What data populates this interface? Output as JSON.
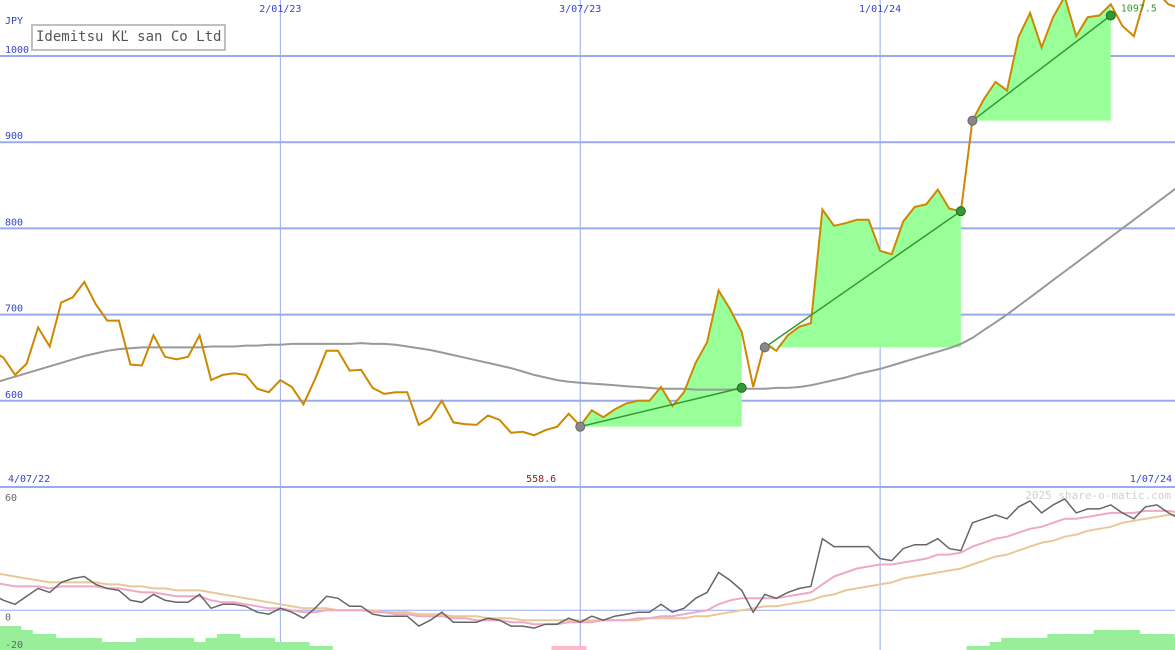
{
  "title": "Idemitsu KĽ san Co Ltd",
  "watermark": "2025 share-o-matic.com",
  "colors": {
    "price": "#cc8800",
    "ma_slow": "#999999",
    "gain_fill": "#99ff99",
    "trend": "#339933",
    "grid": "#99aaee",
    "axis_text": "#3344cc",
    "osc_line": "#666666",
    "osc_fast": "#f0a8c8",
    "osc_slow": "#e8c898",
    "hist_pos": "#99ee99",
    "hist_neg": "#ffb8c8",
    "last_label": "#339933",
    "min_label": "#882222"
  },
  "chart_data": {
    "type": "line",
    "currency": "JPY",
    "date_range": [
      "4/07/22",
      "1/07/24"
    ],
    "x_ticks": [
      {
        "label": "2/01/23",
        "i": 25
      },
      {
        "label": "3/07/23",
        "i": 51
      },
      {
        "label": "1/01/24",
        "i": 77
      }
    ],
    "y_ticks": [
      600,
      700,
      800,
      900,
      1000
    ],
    "ylim": [
      500,
      1065
    ],
    "osc_ticks": [
      60,
      0,
      -20
    ],
    "osc_lim": [
      -20,
      60
    ],
    "min_label": "558.6",
    "last_label": "1097.5",
    "price": [
      658,
      650,
      630,
      643,
      685,
      663,
      714,
      720,
      738,
      712,
      693,
      693,
      642,
      641,
      676,
      651,
      648,
      651,
      676,
      624,
      630,
      632,
      630,
      614,
      610,
      624,
      616,
      596,
      625,
      658,
      658,
      635,
      636,
      615,
      608,
      610,
      610,
      572,
      580,
      600,
      575,
      573,
      572,
      583,
      578,
      563,
      564,
      560,
      566,
      570,
      585,
      571,
      589,
      581,
      590,
      597,
      600,
      600,
      616,
      594,
      610,
      644,
      668,
      728,
      706,
      680,
      616,
      667,
      658,
      676,
      686,
      690,
      822,
      803,
      806,
      810,
      810,
      774,
      770,
      808,
      825,
      828,
      845,
      823,
      820,
      925,
      950,
      970,
      960,
      1022,
      1050,
      1010,
      1045,
      1069,
      1023,
      1045,
      1047,
      1060,
      1035,
      1023,
      1070,
      1074,
      1060,
      1055
    ],
    "ma_slow": [
      620,
      624,
      628,
      632,
      636,
      640,
      644,
      648,
      652,
      655,
      658,
      660,
      661,
      662,
      662,
      662,
      662,
      662,
      662,
      663,
      663,
      663,
      664,
      664,
      665,
      665,
      666,
      666,
      666,
      666,
      666,
      666,
      667,
      666,
      666,
      665,
      663,
      661,
      659,
      656,
      653,
      650,
      647,
      644,
      641,
      638,
      634,
      630,
      627,
      624,
      622,
      621,
      620,
      619,
      618,
      617,
      616,
      615,
      614,
      614,
      614,
      613,
      613,
      613,
      613,
      614,
      614,
      614,
      615,
      615,
      616,
      618,
      621,
      624,
      627,
      631,
      634,
      637,
      641,
      645,
      649,
      653,
      657,
      661,
      666,
      673,
      682,
      691,
      700,
      710,
      720,
      730,
      740,
      750,
      760,
      770,
      780,
      790,
      800,
      810,
      820,
      830,
      840,
      850
    ],
    "trend_segments": [
      {
        "from": [
          51,
          570
        ],
        "to": [
          65,
          615
        ]
      },
      {
        "from": [
          67,
          662
        ],
        "to": [
          84,
          820
        ]
      },
      {
        "from": [
          85,
          925
        ],
        "to": [
          97,
          1047
        ]
      }
    ],
    "oscillator": {
      "line": [
        8,
        5,
        3,
        7,
        11,
        9,
        14,
        16,
        17,
        13,
        11,
        10,
        5,
        4,
        8,
        5,
        4,
        4,
        8,
        1,
        3,
        3,
        2,
        -1,
        -2,
        1,
        -1,
        -4,
        1,
        7,
        6,
        2,
        2,
        -2,
        -3,
        -3,
        -3,
        -8,
        -5,
        -1,
        -6,
        -6,
        -6,
        -4,
        -5,
        -8,
        -8,
        -9,
        -7,
        -7,
        -4,
        -6,
        -3,
        -5,
        -3,
        -2,
        -1,
        -1,
        3,
        -1,
        1,
        6,
        9,
        19,
        15,
        10,
        -1,
        8,
        6,
        9,
        11,
        12,
        36,
        32,
        32,
        32,
        32,
        26,
        25,
        31,
        33,
        33,
        36,
        31,
        30,
        44,
        46,
        48,
        46,
        52,
        55,
        49,
        53,
        56,
        49,
        51,
        51,
        53,
        49,
        46,
        52,
        53,
        49,
        46
      ],
      "fast": [
        14,
        13,
        12,
        12,
        12,
        11,
        12,
        12,
        12,
        12,
        11,
        11,
        10,
        9,
        9,
        8,
        7,
        7,
        7,
        5,
        4,
        4,
        3,
        2,
        1,
        1,
        0,
        -1,
        -1,
        0,
        0,
        0,
        0,
        -1,
        -1,
        -2,
        -2,
        -3,
        -3,
        -3,
        -4,
        -4,
        -5,
        -5,
        -5,
        -6,
        -6,
        -7,
        -7,
        -7,
        -6,
        -6,
        -6,
        -5,
        -5,
        -5,
        -4,
        -4,
        -3,
        -3,
        -2,
        -1,
        0,
        3,
        5,
        6,
        6,
        6,
        6,
        7,
        8,
        9,
        13,
        17,
        19,
        21,
        22,
        23,
        23,
        24,
        25,
        26,
        28,
        28,
        29,
        32,
        34,
        36,
        37,
        39,
        41,
        42,
        44,
        46,
        46,
        47,
        48,
        49,
        49,
        49,
        50,
        50,
        50,
        49
      ],
      "slow": [
        19,
        18,
        17,
        16,
        15,
        14,
        14,
        14,
        14,
        14,
        13,
        13,
        12,
        12,
        11,
        11,
        10,
        10,
        10,
        9,
        8,
        7,
        6,
        5,
        4,
        3,
        2,
        1,
        1,
        1,
        0,
        0,
        0,
        0,
        -1,
        -1,
        -1,
        -2,
        -2,
        -2,
        -3,
        -3,
        -3,
        -4,
        -4,
        -4,
        -5,
        -5,
        -5,
        -5,
        -5,
        -5,
        -5,
        -5,
        -5,
        -5,
        -5,
        -4,
        -4,
        -4,
        -4,
        -3,
        -3,
        -2,
        -1,
        0,
        1,
        2,
        2,
        3,
        4,
        5,
        7,
        8,
        10,
        11,
        12,
        13,
        14,
        16,
        17,
        18,
        19,
        20,
        21,
        23,
        25,
        27,
        28,
        30,
        32,
        34,
        35,
        37,
        38,
        40,
        41,
        42,
        44,
        45,
        46,
        47,
        48,
        48
      ],
      "histogram": [
        -6,
        -6,
        -6,
        -5,
        -4,
        -4,
        -3,
        -3,
        -3,
        -3,
        -2,
        -2,
        -2,
        -3,
        -3,
        -3,
        -3,
        -3,
        -2,
        -3,
        -4,
        -4,
        -3,
        -3,
        -3,
        -2,
        -2,
        -2,
        -1,
        -1,
        0,
        0,
        0,
        0,
        0,
        0,
        0,
        0,
        0,
        0,
        0,
        0,
        0,
        0,
        0,
        0,
        0,
        0,
        0,
        1,
        1,
        1,
        0,
        0,
        0,
        0,
        0,
        0,
        0,
        0,
        0,
        0,
        0,
        0,
        0,
        0,
        0,
        0,
        0,
        0,
        0,
        0,
        0,
        0,
        0,
        0,
        0,
        0,
        0,
        0,
        0,
        0,
        0,
        0,
        0,
        -1,
        -1,
        -2,
        -3,
        -3,
        -3,
        -3,
        -4,
        -4,
        -4,
        -4,
        -5,
        -5,
        -5,
        -5,
        -4,
        -4,
        -4,
        -3
      ]
    }
  }
}
